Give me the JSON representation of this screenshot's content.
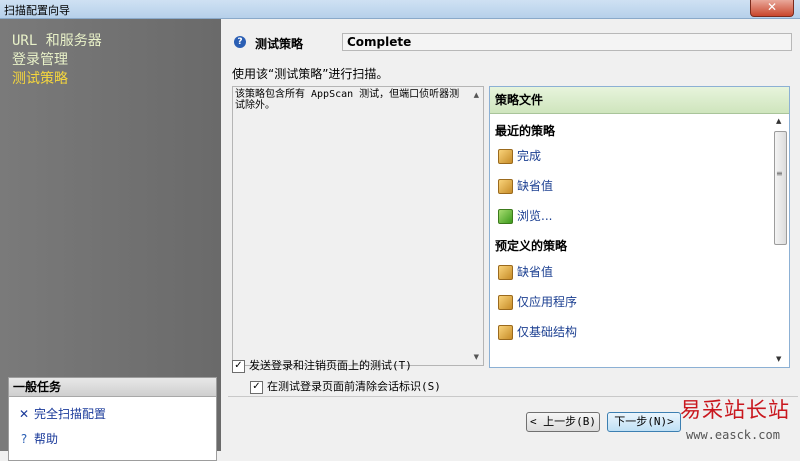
{
  "window": {
    "title": "扫描配置向导",
    "close_glyph": "✕"
  },
  "sidebar": {
    "links": [
      {
        "label": "URL 和服务器",
        "active": false
      },
      {
        "label": "登录管理",
        "active": false
      },
      {
        "label": "测试策略",
        "active": true
      }
    ],
    "tasks": {
      "title": "一般任务",
      "items": [
        {
          "label": "完全扫描配置",
          "icon": "tools-icon"
        },
        {
          "label": "帮助",
          "icon": "help-icon"
        }
      ]
    }
  },
  "main": {
    "strategy_label": "测试策略",
    "strategy_value": "Complete",
    "instruction": "使用该“测试策略”进行扫描。",
    "description": "该策略包含所有 AppScan 测试，但端口侦听器测试除外。",
    "policy_panel": {
      "title": "策略文件",
      "recent_header": "最近的策略",
      "recent": [
        {
          "label": "完成",
          "icon": "policy-file-icon"
        },
        {
          "label": "缺省值",
          "icon": "policy-file-icon"
        },
        {
          "label": "浏览...",
          "icon": "browse-folder-icon"
        }
      ],
      "predefined_header": "预定义的策略",
      "predefined": [
        {
          "label": "缺省值",
          "icon": "policy-file-icon"
        },
        {
          "label": "仅应用程序",
          "icon": "policy-file-icon"
        },
        {
          "label": "仅基础结构",
          "icon": "policy-file-icon"
        }
      ]
    },
    "checkboxes": [
      {
        "label": "发送登录和注销页面上的测试(T)",
        "checked": true
      },
      {
        "label": "在测试登录页面前清除会话标识(S)",
        "checked": true
      }
    ],
    "buttons": {
      "back": "< 上一步(B)",
      "next": "下一步(N)>"
    }
  },
  "watermark": {
    "text": "易采站长站",
    "url": "www.easck.com"
  },
  "colors": {
    "sidebar_active": "#f5d63d",
    "sidebar_link": "#e8f1c8",
    "link": "#1b3f91",
    "watermark": "#c9171e"
  }
}
